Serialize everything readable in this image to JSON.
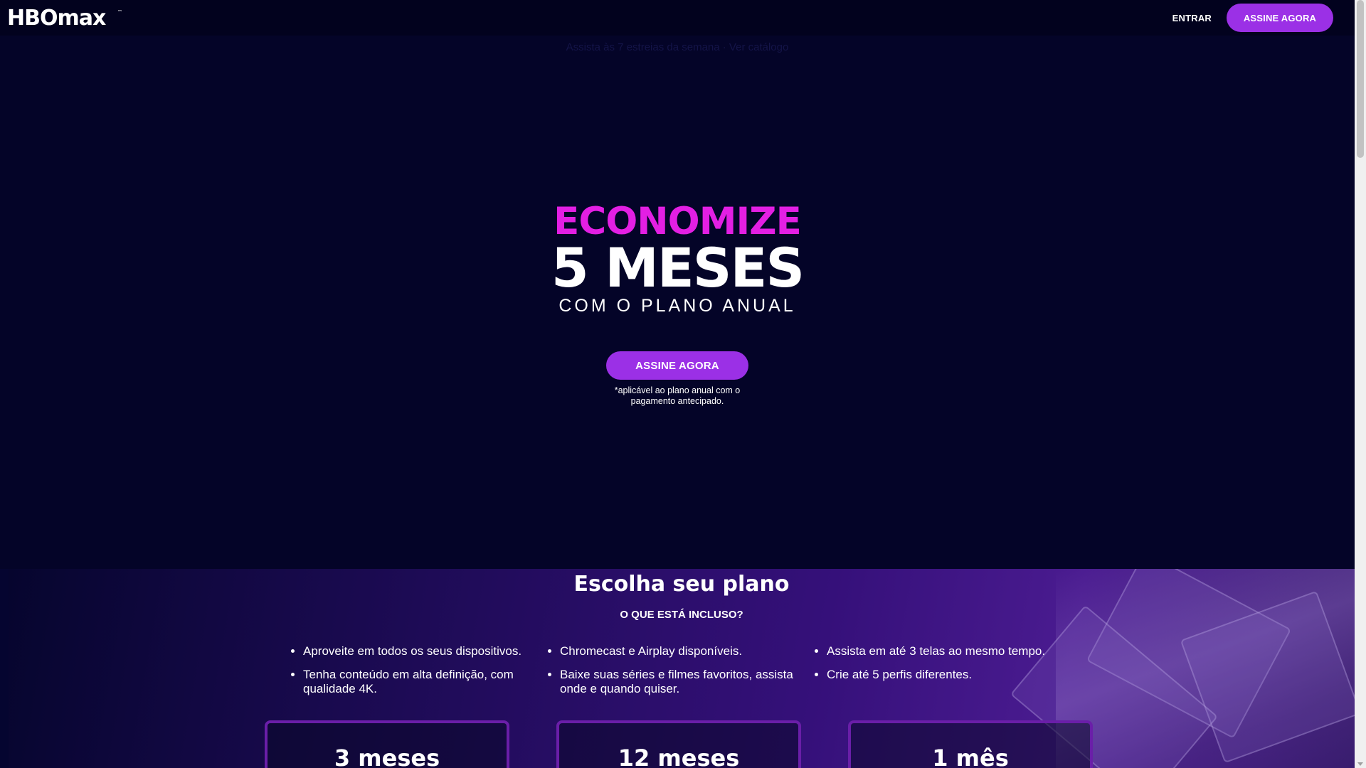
{
  "header": {
    "logo_text": "HBOmax",
    "entrar_label": "ENTRAR",
    "assine_label": "ASSINE AGORA"
  },
  "promo_bar": {
    "text": "Assista às 7 estreias da semana · Ver catálogo"
  },
  "hero": {
    "line1": "ECONOMIZE",
    "line2": "5 MESES",
    "line3": "COM O PLANO ANUAL",
    "cta_label": "ASSINE AGORA",
    "note": "*aplicável ao plano anual com o pagamento antecipado."
  },
  "plans": {
    "title": "Escolha seu plano",
    "subtitle": "O QUE ESTÁ INCLUSO?",
    "features": [
      [
        "Aproveite em todos os seus dispositivos.",
        "Tenha conteúdo em alta definição, com qualidade 4K."
      ],
      [
        "Chromecast e Airplay disponíveis.",
        "Baixe suas séries e filmes favoritos, assista onde e quando quiser."
      ],
      [
        "Assista em até 3 telas ao mesmo tempo.",
        "Crie até 5 perfis diferentes."
      ]
    ],
    "cards": [
      "3 meses",
      "12 meses",
      "1 mês"
    ]
  },
  "colors": {
    "accent": "#9b30e6",
    "magenta": "#e31fe3",
    "background": "#040428"
  }
}
